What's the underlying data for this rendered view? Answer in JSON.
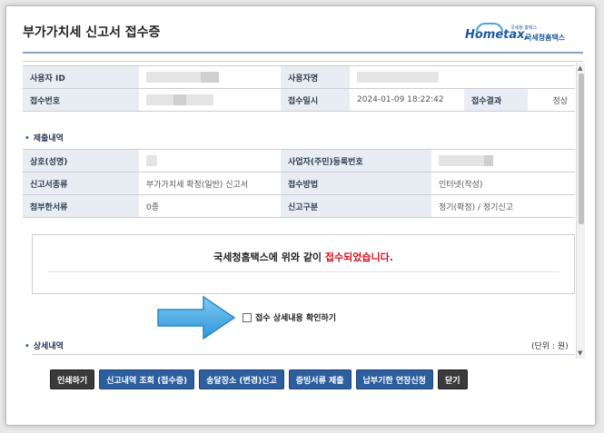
{
  "dialog": {
    "title": "부가가치세 신고서 접수증",
    "logo": {
      "brand": "Hometax,",
      "korean": "국세청홈택스",
      "tagline": "국세청 홈택스"
    }
  },
  "info_rows": [
    {
      "left_label": "사용자 ID",
      "left_value": "",
      "right_label": "사용자명",
      "right_value": ""
    },
    {
      "left_label": "접수번호",
      "left_value": "",
      "right_label": "접수일시",
      "right_value": "2024-01-09 18:22:42",
      "extra_label": "접수결과",
      "extra_value": "정상"
    }
  ],
  "submission": {
    "heading": "제출내역",
    "rows": [
      {
        "left_label": "상호(성명)",
        "left_value": "",
        "right_label": "사업자(주민)등록번호",
        "right_value": ""
      },
      {
        "left_label": "신고서종류",
        "left_value": "부가가치세 확정(일반) 신고서",
        "right_label": "접수방법",
        "right_value": "인터넷(작성)"
      },
      {
        "left_label": "첨부한서류",
        "left_value": "0종",
        "right_label": "신고구분",
        "right_value": "정기(확정) / 정기신고"
      }
    ]
  },
  "message": {
    "before": "국세청홈택스에 위와 같이 ",
    "highlight": "접수되었습니다.",
    "highlight_color": "#d4121f"
  },
  "checkbox": {
    "label": "접수 상세내용 확인하기",
    "checked": false
  },
  "details": {
    "heading": "상세내역",
    "unit": "(단위 : 원)"
  },
  "buttons": [
    {
      "label": "인쇄하기",
      "style": "dark"
    },
    {
      "label": "신고내역 조회 (접수증)",
      "style": "blue"
    },
    {
      "label": "송달장소 (변경)신고",
      "style": "blue"
    },
    {
      "label": "증빙서류 제출",
      "style": "blue"
    },
    {
      "label": "납부기한 연장신청",
      "style": "blue"
    },
    {
      "label": "닫기",
      "style": "dark"
    }
  ],
  "colors": {
    "label_bg": "#e8edf3",
    "button_blue": "#2d5e9e",
    "button_dark": "#3a3a3a",
    "arrow": "#3fa9e6"
  },
  "icons": {
    "arrow": "arrow-right-icon",
    "scroll_up": "chevron-up-icon",
    "scroll_down": "chevron-down-icon"
  }
}
